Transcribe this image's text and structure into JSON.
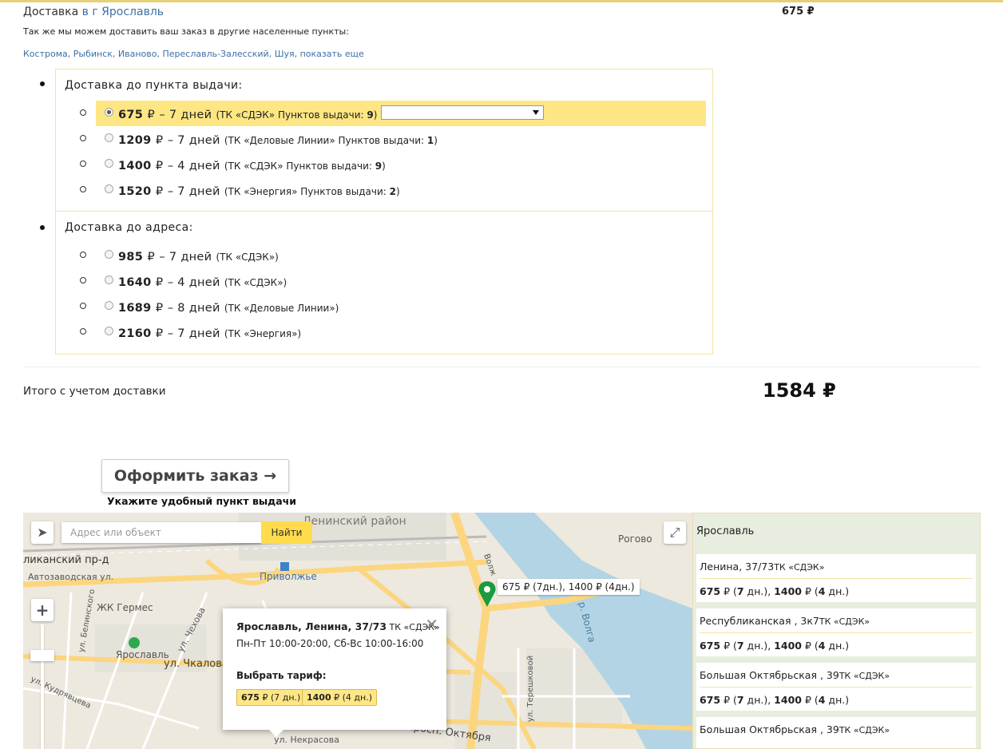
{
  "header": {
    "title_prefix": "Доставка ",
    "title_city": "в г Ярославль",
    "price": "675 ₽",
    "also_text": "Так же мы можем доставить ваш заказ в другие населенные пункты:",
    "cities": [
      "Кострома",
      "Рыбинск",
      "Иваново",
      "Переславль-Залесский",
      "Шуя",
      "показать еще"
    ]
  },
  "pickup": {
    "title": "Доставка до пункта выдачи:",
    "options": [
      {
        "price": "675",
        "rub": "₽",
        "days": "– 7 дней",
        "carrier": "(ТК «СДЭК» Пунктов выдачи: ",
        "count": "9",
        "close": ")",
        "selected": true
      },
      {
        "price": "1209",
        "rub": "₽",
        "days": "– 7 дней",
        "carrier": "(ТК «Деловые Линии» Пунктов выдачи: ",
        "count": "1",
        "close": ")",
        "selected": false
      },
      {
        "price": "1400",
        "rub": "₽",
        "days": "– 4 дней",
        "carrier": "(ТК «СДЭК» Пунктов выдачи: ",
        "count": "9",
        "close": ")",
        "selected": false
      },
      {
        "price": "1520",
        "rub": "₽",
        "days": "– 7 дней",
        "carrier": "(ТК «Энергия» Пунктов выдачи: ",
        "count": "2",
        "close": ")",
        "selected": false
      }
    ]
  },
  "address": {
    "title": "Доставка до адреса:",
    "options": [
      {
        "price": "985",
        "rub": "₽",
        "days": "– 7 дней",
        "carrier": "(ТК «СДЭК»)"
      },
      {
        "price": "1640",
        "rub": "₽",
        "days": "– 4 дней",
        "carrier": "(ТК «СДЭК»)"
      },
      {
        "price": "1689",
        "rub": "₽",
        "days": "– 8 дней",
        "carrier": "(ТК «Деловые Линии»)"
      },
      {
        "price": "2160",
        "rub": "₽",
        "days": "– 7 дней",
        "carrier": "(ТК «Энергия»)"
      }
    ]
  },
  "total": {
    "label": "Итого с учетом доставки",
    "sum": "1584 ₽"
  },
  "order": {
    "button": "Оформить заказ →",
    "hint": "Укажите удобный пункт выдачи"
  },
  "map": {
    "search_placeholder": "Адрес или объект",
    "search_button": "Найти",
    "labels": {
      "district": "Ленинский район",
      "rogovo": "Рогово",
      "respublikansky": "ликанский пр-д",
      "avtozavodskaya": "Автозаводская ул.",
      "privolzhe": "Приволжье",
      "zhk": "ЖК Гермес",
      "yaroslavl_station": "Ярославль",
      "chkalova": "ул. Чкалова",
      "chekhova": "ул. Чехова",
      "belinskogo": "ул. Белинского",
      "kudryavtseva": "ул. Кудрявцева",
      "volga": "р. Волга",
      "tereshkovoy": "ул. Терешковой",
      "nekrasova": "ул. Некрасова",
      "oktyabrya": "просп. Октября",
      "volzh": "Волж"
    },
    "marker_label": "675 ₽ (7дн.), 1400 ₽ (4дн.)",
    "balloon": {
      "address": "Ярославль, Ленина, 37/73",
      "carrier": " ТК «СДЭК»",
      "hours": "Пн-Пт 10:00-20:00, Сб-Вс 10:00-16:00",
      "choose": "Выбрать тариф:",
      "tariffs": [
        {
          "price": "675",
          "rest": " ₽ (",
          "days": "7",
          "unit": " дн.)"
        },
        {
          "price": "1400",
          "rest": " ₽ (",
          "days": "4",
          "unit": " дн.)"
        }
      ]
    },
    "colors": {
      "water": "#b3d4e4",
      "road": "#fcd57f",
      "ground": "#ede9df",
      "marker": "#1a9b3e"
    }
  },
  "sidebar": {
    "city": "Ярославль",
    "points": [
      {
        "name": "Ленина, 37/73",
        "tk": "ТК «СДЭК»",
        "p1": "675",
        "d1": "7",
        "p2": "1400",
        "d2": "4"
      },
      {
        "name": "Республиканская , 3к7",
        "tk": "ТК «СДЭК»",
        "p1": "675",
        "d1": "7",
        "p2": "1400",
        "d2": "4"
      },
      {
        "name": "Большая Октябрьская , 39",
        "tk": "ТК «СДЭК»",
        "p1": "675",
        "d1": "7",
        "p2": "1400",
        "d2": "4"
      },
      {
        "name": "Большая Октябрьская , 39",
        "tk": "ТК «СДЭК»",
        "p1": "",
        "d1": "",
        "p2": "",
        "d2": ""
      }
    ],
    "rub": " ₽ (",
    "unit": " дн.), ",
    "unit_last": " дн.)"
  }
}
